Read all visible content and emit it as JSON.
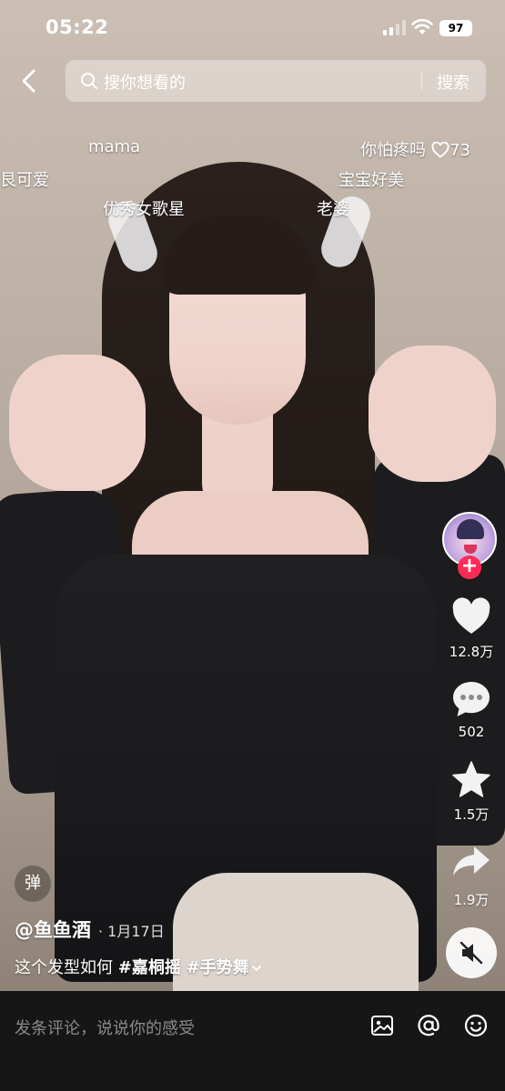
{
  "status_bar": {
    "time": "05:22",
    "battery": "97"
  },
  "search": {
    "placeholder": "搜你想看的",
    "button_label": "搜索"
  },
  "danmaku": [
    {
      "text": "mama"
    },
    {
      "text": "你怕疼吗"
    },
    {
      "text": "73"
    },
    {
      "text": "艮可爱"
    },
    {
      "text": "宝宝好美"
    },
    {
      "text": "优秀女歌星"
    },
    {
      "text": "老婆"
    }
  ],
  "actions": {
    "likes": "12.8万",
    "comments": "502",
    "favorites": "1.5万",
    "shares": "1.9万"
  },
  "video_info": {
    "danmu_toggle": "弹",
    "author": "@鱼鱼酒",
    "date": "1月17日",
    "caption_text": "这个发型如何",
    "hashtags": [
      "#嘉桐摇",
      "#手势舞"
    ]
  },
  "comment_bar": {
    "placeholder": "发条评论，说说你的感受"
  },
  "colors": {
    "accent": "#fe2c55",
    "comment_bar_bg": "#161616"
  }
}
